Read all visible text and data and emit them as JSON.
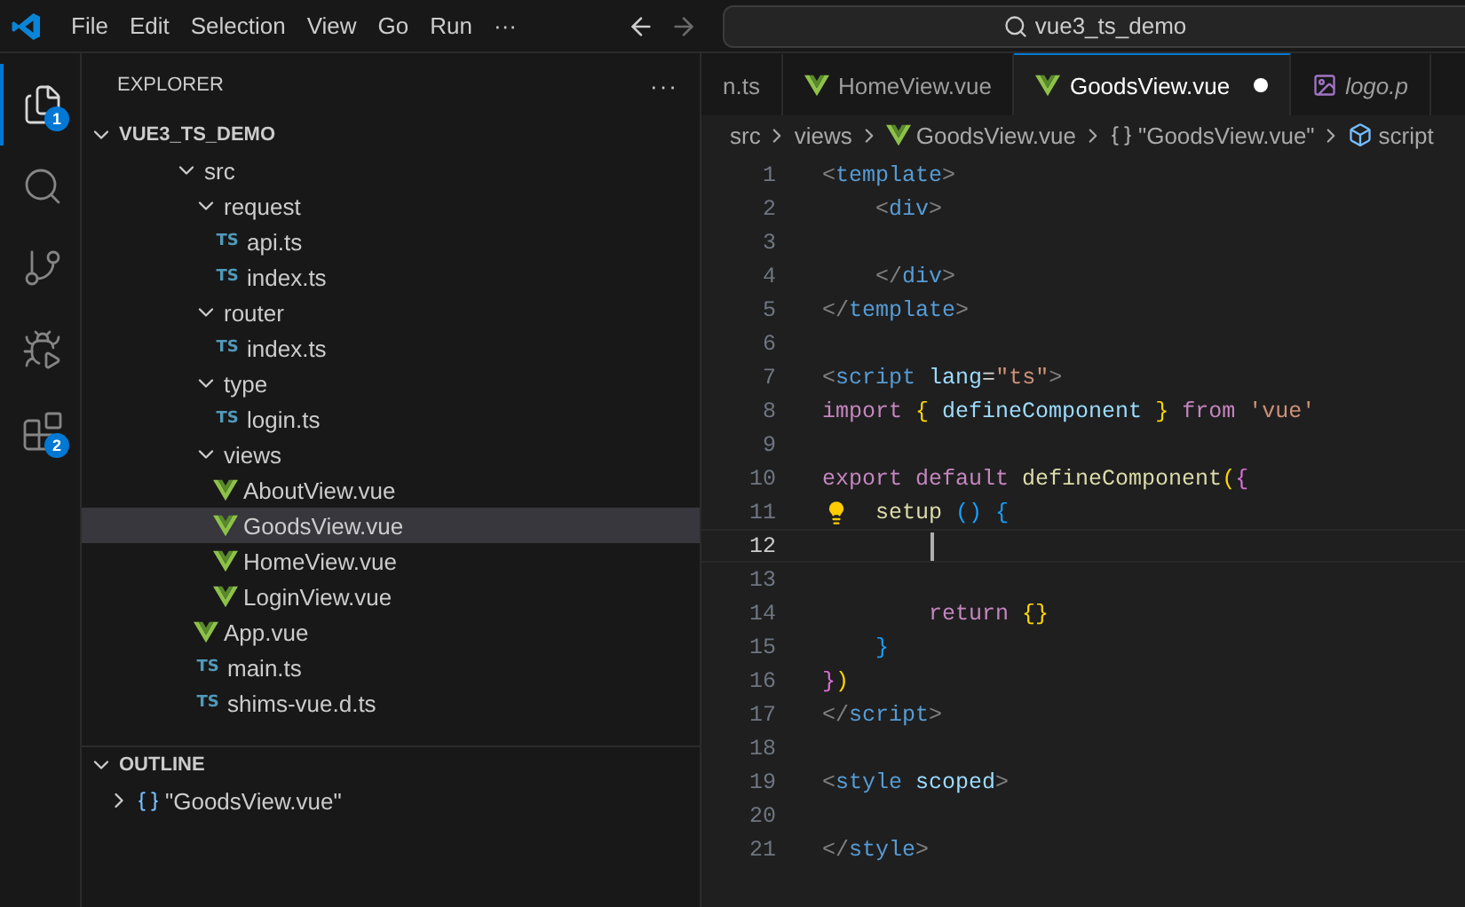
{
  "menu_bar": {
    "items": [
      "File",
      "Edit",
      "Selection",
      "View",
      "Go",
      "Run"
    ],
    "overflow": "···"
  },
  "command_center": {
    "text": "vue3_ts_demo"
  },
  "activity_bar": [
    {
      "kind": "explorer",
      "selected": true,
      "badge": "1"
    },
    {
      "kind": "search",
      "selected": false
    },
    {
      "kind": "source-control",
      "selected": false
    },
    {
      "kind": "run-debug",
      "selected": false
    },
    {
      "kind": "extensions",
      "selected": false,
      "badge": "2"
    }
  ],
  "explorer": {
    "title": "EXPLORER",
    "more": "···",
    "project": {
      "label": "VUE3_TS_DEMO",
      "expanded": true
    },
    "tree": [
      {
        "label": "src",
        "kind": "folder",
        "expanded": true,
        "selected": false,
        "children": [
          {
            "label": "request",
            "kind": "folder",
            "expanded": true,
            "selected": false,
            "children": [
              {
                "label": "api.ts",
                "kind": "ts",
                "icon": "TS",
                "selected": false
              },
              {
                "label": "index.ts",
                "kind": "ts",
                "icon": "TS",
                "selected": false
              }
            ]
          },
          {
            "label": "router",
            "kind": "folder",
            "expanded": true,
            "selected": false,
            "children": [
              {
                "label": "index.ts",
                "kind": "ts",
                "icon": "TS",
                "selected": false
              }
            ]
          },
          {
            "label": "type",
            "kind": "folder",
            "expanded": true,
            "selected": false,
            "children": [
              {
                "label": "login.ts",
                "kind": "ts",
                "icon": "TS",
                "selected": false
              }
            ]
          },
          {
            "label": "views",
            "kind": "folder",
            "expanded": true,
            "selected": false,
            "children": [
              {
                "label": "AboutView.vue",
                "kind": "vue",
                "selected": false
              },
              {
                "label": "GoodsView.vue",
                "kind": "vue",
                "selected": true
              },
              {
                "label": "HomeView.vue",
                "kind": "vue",
                "selected": false
              },
              {
                "label": "LoginView.vue",
                "kind": "vue",
                "selected": false
              }
            ]
          },
          {
            "label": "App.vue",
            "kind": "vue",
            "selected": false
          },
          {
            "label": "main.ts",
            "kind": "ts",
            "icon": "TS",
            "selected": false
          },
          {
            "label": "shims-vue.d.ts",
            "kind": "ts",
            "icon": "TS",
            "selected": false
          }
        ]
      }
    ]
  },
  "outline": {
    "title": "OUTLINE",
    "expanded": true,
    "items": [
      {
        "label": "\"GoodsView.vue\"",
        "expanded": false
      }
    ]
  },
  "tabs": [
    {
      "label": "n.ts",
      "kind": "plain",
      "selected": false,
      "modified": false,
      "preview": false
    },
    {
      "label": "HomeView.vue",
      "kind": "vue",
      "selected": false,
      "modified": false,
      "preview": false
    },
    {
      "label": "GoodsView.vue",
      "kind": "vue",
      "selected": true,
      "modified": true,
      "preview": false
    },
    {
      "label": "logo.p",
      "kind": "image",
      "selected": false,
      "modified": false,
      "preview": true
    }
  ],
  "breadcrumb": [
    {
      "label": "src",
      "kind": "folder"
    },
    {
      "label": "views",
      "kind": "folder"
    },
    {
      "label": "GoodsView.vue",
      "kind": "vue"
    },
    {
      "label": "\"GoodsView.vue\"",
      "kind": "module"
    },
    {
      "label": "script",
      "kind": "element"
    }
  ],
  "editor": {
    "lines": [
      {
        "number": "1",
        "current": false,
        "lightbulb": false,
        "tokens": [
          {
            "text": "<",
            "kind": "punct"
          },
          {
            "text": "template",
            "kind": "tag"
          },
          {
            "text": ">",
            "kind": "punct"
          }
        ]
      },
      {
        "number": "2",
        "current": false,
        "lightbulb": false,
        "tokens": [
          {
            "text": "    <",
            "kind": "punct"
          },
          {
            "text": "div",
            "kind": "tag"
          },
          {
            "text": ">",
            "kind": "punct"
          }
        ]
      },
      {
        "number": "3",
        "current": false,
        "lightbulb": false
      },
      {
        "number": "4",
        "current": false,
        "lightbulb": false,
        "tokens": [
          {
            "text": "    </",
            "kind": "punct"
          },
          {
            "text": "div",
            "kind": "tag"
          },
          {
            "text": ">",
            "kind": "punct"
          }
        ]
      },
      {
        "number": "5",
        "current": false,
        "lightbulb": false,
        "tokens": [
          {
            "text": "</",
            "kind": "punct"
          },
          {
            "text": "template",
            "kind": "tag"
          },
          {
            "text": ">",
            "kind": "punct"
          }
        ]
      },
      {
        "number": "6",
        "current": false,
        "lightbulb": false
      },
      {
        "number": "7",
        "current": false,
        "lightbulb": false,
        "tokens": [
          {
            "text": "<",
            "kind": "punct"
          },
          {
            "text": "script",
            "kind": "tag"
          },
          {
            "text": " lang",
            "kind": "attr"
          },
          {
            "text": "=",
            "kind": "plain"
          },
          {
            "text": "\"ts\"",
            "kind": "string"
          },
          {
            "text": ">",
            "kind": "punct"
          }
        ]
      },
      {
        "number": "8",
        "current": false,
        "lightbulb": false,
        "tokens": [
          {
            "text": "import ",
            "kind": "keyword"
          },
          {
            "text": "{",
            "kind": "bracket1"
          },
          {
            "text": " defineComponent ",
            "kind": "variable"
          },
          {
            "text": "}",
            "kind": "bracket1"
          },
          {
            "text": " from ",
            "kind": "keyword"
          },
          {
            "text": "'vue'",
            "kind": "string"
          }
        ]
      },
      {
        "number": "9",
        "current": false,
        "lightbulb": false
      },
      {
        "number": "10",
        "current": false,
        "lightbulb": false,
        "tokens": [
          {
            "text": "export default ",
            "kind": "keyword"
          },
          {
            "text": "defineComponent",
            "kind": "function"
          },
          {
            "text": "(",
            "kind": "bracket1"
          },
          {
            "text": "{",
            "kind": "bracket2"
          }
        ]
      },
      {
        "number": "11",
        "current": false,
        "lightbulb": true,
        "tokens": [
          {
            "text": "    setup ",
            "kind": "function"
          },
          {
            "text": "() {",
            "kind": "bracket3"
          }
        ]
      },
      {
        "number": "12",
        "current": true,
        "lightbulb": false
      },
      {
        "number": "13",
        "current": false,
        "lightbulb": false
      },
      {
        "number": "14",
        "current": false,
        "lightbulb": false,
        "tokens": [
          {
            "text": "        return ",
            "kind": "keyword"
          },
          {
            "text": "{}",
            "kind": "bracket1"
          }
        ]
      },
      {
        "number": "15",
        "current": false,
        "lightbulb": false,
        "tokens": [
          {
            "text": "    }",
            "kind": "bracket3"
          }
        ]
      },
      {
        "number": "16",
        "current": false,
        "lightbulb": false,
        "tokens": [
          {
            "text": "}",
            "kind": "bracket2"
          },
          {
            "text": ")",
            "kind": "bracket1"
          }
        ]
      },
      {
        "number": "17",
        "current": false,
        "lightbulb": false,
        "tokens": [
          {
            "text": "</",
            "kind": "punct"
          },
          {
            "text": "script",
            "kind": "tag"
          },
          {
            "text": ">",
            "kind": "punct"
          }
        ]
      },
      {
        "number": "18",
        "current": false,
        "lightbulb": false
      },
      {
        "number": "19",
        "current": false,
        "lightbulb": false,
        "tokens": [
          {
            "text": "<",
            "kind": "punct"
          },
          {
            "text": "style",
            "kind": "tag"
          },
          {
            "text": " scoped",
            "kind": "attr"
          },
          {
            "text": ">",
            "kind": "punct"
          }
        ]
      },
      {
        "number": "20",
        "current": false,
        "lightbulb": false
      },
      {
        "number": "21",
        "current": false,
        "lightbulb": false,
        "tokens": [
          {
            "text": "</",
            "kind": "punct"
          },
          {
            "text": "style",
            "kind": "tag"
          },
          {
            "text": ">",
            "kind": "punct"
          }
        ]
      }
    ]
  }
}
